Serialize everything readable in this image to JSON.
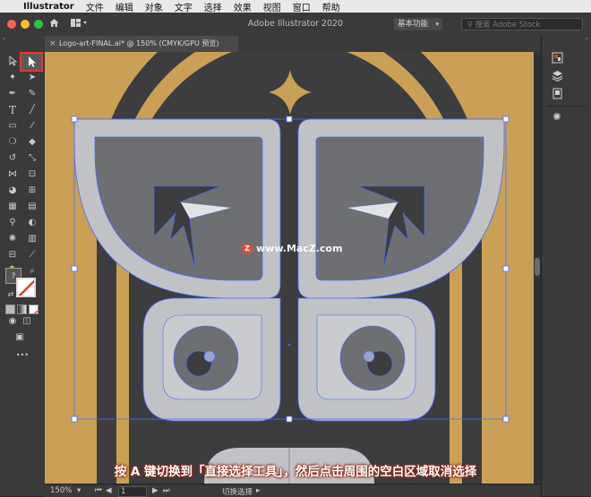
{
  "menubar": {
    "apple": "",
    "app_name": "Illustrator",
    "items": [
      "文件",
      "编辑",
      "对象",
      "文字",
      "选择",
      "效果",
      "视图",
      "窗口",
      "帮助"
    ]
  },
  "window": {
    "title": "Adobe Illustrator 2020",
    "workspace": "基本功能",
    "search_placeholder": "搜索 Adobe Stock"
  },
  "document_tab": {
    "label": "Logo-art-FINAL.ai* @ 150% (CMYK/GPU 预览)",
    "close": "×"
  },
  "toolbar": {
    "fill_stroke_hint": "?",
    "more": "•••"
  },
  "status": {
    "zoom": "150%",
    "artboard": "1",
    "mode": "切换选择"
  },
  "watermark": {
    "logo": "Z",
    "text": "www.MacZ.com"
  },
  "caption": "按 A 键切换到「直接选择工具」，然后点击周围的空白区域取消选择",
  "colors": {
    "gold": "#c9a055",
    "dark": "#3d3d3f",
    "wing_light": "#c0c2c6",
    "wing_dark": "#6e6f72",
    "selection": "#4a6cff",
    "highlight": "#e53b2c"
  }
}
